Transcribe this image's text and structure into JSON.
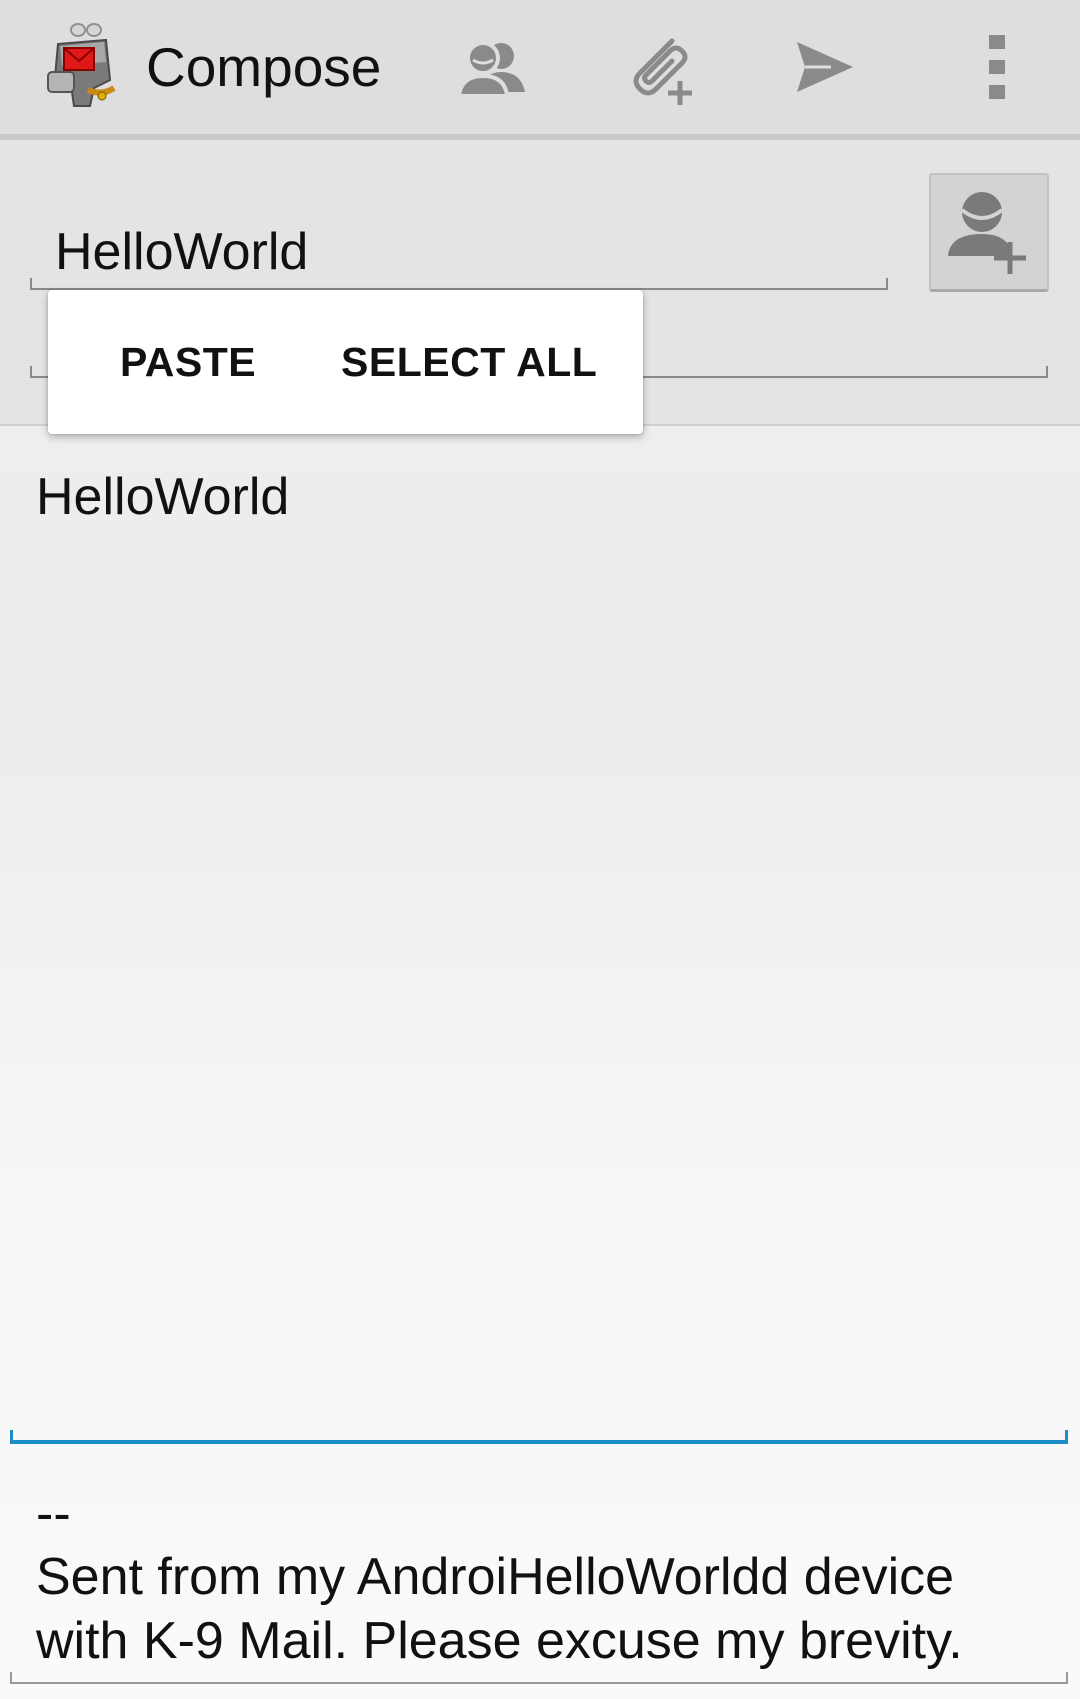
{
  "appbar": {
    "title": "Compose",
    "logo_icon": "k9-mail-logo-icon",
    "actions": [
      {
        "name": "contacts-icon"
      },
      {
        "name": "attach-icon"
      },
      {
        "name": "send-icon"
      },
      {
        "name": "overflow-menu-icon"
      }
    ],
    "background": "#dedede",
    "icon_color": "#8a8a8a"
  },
  "compose": {
    "to_value": "HelloWorld",
    "add_contact_icon": "add-contact-icon"
  },
  "context_menu": {
    "paste_label": "PASTE",
    "select_all_label": "SELECT ALL"
  },
  "message": {
    "body": "HelloWorld",
    "focus_color": "#1a8cc6"
  },
  "signature": {
    "separator": "--",
    "text": "Sent from my AndroiHelloWorldd device with K-9 Mail. Please excuse my brevity."
  }
}
